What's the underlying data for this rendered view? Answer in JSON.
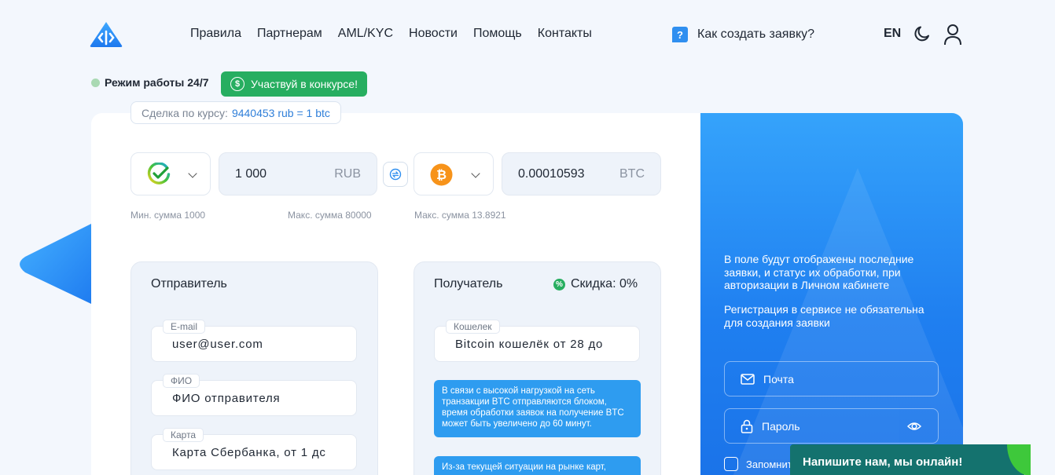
{
  "header": {
    "nav": [
      "Правила",
      "Партнерам",
      "AML/KYC",
      "Новости",
      "Помощь",
      "Контакты"
    ],
    "howto_icon": "?",
    "howto_label": "Как создать заявку?",
    "lang": "EN",
    "icons": [
      "logo-icon",
      "moon-icon",
      "user-icon",
      "question-icon"
    ]
  },
  "status": {
    "mode": "Режим работы 24/7",
    "contest": "Участвуй в конкурсе!",
    "contest_icon": "$"
  },
  "rate": {
    "label": "Сделка по курсу:",
    "value": "9440453 rub = 1 btc"
  },
  "exchange": {
    "from_icon": "sberbank-icon",
    "from_amount": "1 000",
    "from_currency": "RUB",
    "to_icon": "bitcoin-icon",
    "to_amount": "0.00010593",
    "to_currency": "BTC",
    "min_send": "Мин. сумма 1000",
    "max_send": "Макс. сумма 80000",
    "max_receive": "Макс. сумма 13.8921"
  },
  "sender": {
    "title": "Отправитель",
    "email_label": "E-mail",
    "email_value": "user@user.com",
    "name_label": "ФИО",
    "name_value": "ФИО отправителя",
    "card_label": "Карта",
    "card_value": "Карта Сбербанка, от 1 дс"
  },
  "receiver": {
    "title": "Получатель",
    "discount": "Скидка: 0%",
    "wallet_label": "Кошелек",
    "wallet_value": "Bitcoin кошелёк от 28 до",
    "notice1": "В связи с высокой нагрузкой на сеть транзакции BTC отправляются блоком, время обработки заявок на получение BTC может быть увеличено до 60 минут.",
    "notice2": "Из-за текущей ситуации на рынке карт,"
  },
  "auth": {
    "info1": "В поле будут отображены последние заявки, и статус их обработки, при авторизации в Личном кабинете",
    "info2": "Регистрация в сервисе не обязательна для создания заявки",
    "email_placeholder": "Почта",
    "password_placeholder": "Пароль",
    "remember": "Запомнить"
  },
  "chat": {
    "label": "Напишите нам, мы онлайн!"
  },
  "colors": {
    "accent_blue": "#2f8ff0",
    "green": "#27ae60",
    "chat_teal": "#14726e"
  }
}
